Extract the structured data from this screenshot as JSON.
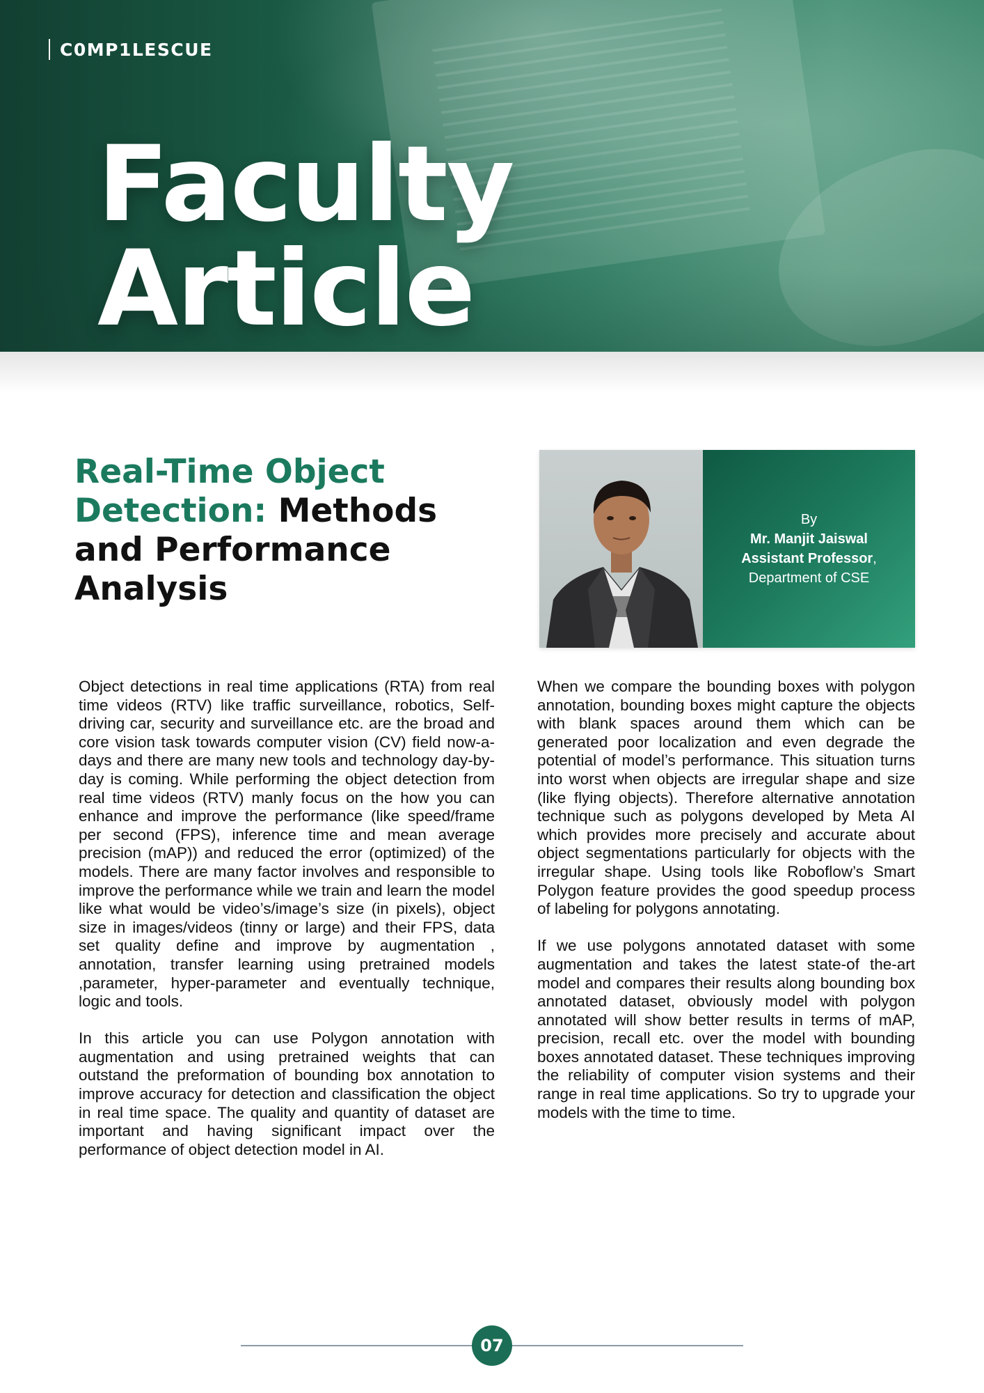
{
  "header": {
    "logo": "C0MP1LESCUE",
    "title_line1": "Faculty",
    "title_line2": "Article"
  },
  "article": {
    "title_accent": "Real-Time Object Detection:",
    "title_rest": "Methods and Performance Analysis"
  },
  "author": {
    "by": "By",
    "name": "Mr. Manjit Jaiswal",
    "role": "Assistant Professor",
    "role_suffix": ",",
    "department": "Department of CSE"
  },
  "body": {
    "left": [
      "Object detections in real time applications (RTA) from real time videos (RTV) like traffic surveillance, robotics, Self-driving car, security and surveillance etc. are the broad and core vision task towards computer vision (CV) field now-a-days and there are many new tools and technology day-by-day is coming. While performing the object detection from real time videos (RTV) manly focus on the how you can enhance and improve the performance (like speed/frame per second (FPS), inference time and mean average precision (mAP)) and reduced the error (optimized) of the models. There are many factor involves and responsible to improve the performance while we train and learn the model like what would be video’s/image’s size (in pixels), object size in images/videos (tinny or large) and their FPS, data set quality define and improve by augmentation , annotation, transfer learning using pretrained models ,parameter, hyper-parameter and eventually technique, logic and tools.",
      "In this article you can use Polygon annotation with augmentation and using pretrained weights that can outstand the preformation of bounding box annotation to improve accuracy for detection and classification the object in real time space. The quality and quantity of dataset are important and having significant impact over the performance of object detection model in AI."
    ],
    "right": [
      "When we compare the bounding boxes with polygon annotation, bounding boxes might capture the objects with blank spaces around them which can be generated poor localization and even degrade the potential of model’s performance. This situation turns into worst when objects are irregular shape and size (like flying objects). Therefore alternative annotation technique such as polygons developed by Meta AI which provides more precisely and accurate about object segmentations particularly for objects with the irregular shape. Using tools like Roboflow’s Smart Polygon feature provides the good speedup process of labeling for polygons annotating.",
      "If we use polygons annotated dataset with some augmentation and takes the latest state-of the-art model and compares their results along bounding box annotated dataset, obviously model with polygon annotated will show better results in terms of mAP, precision, recall etc. over the model with bounding boxes annotated dataset. These techniques improving the reliability of computer vision systems and their range in real time applications. So try to upgrade your models with the time to time."
    ]
  },
  "footer": {
    "page_number": "07"
  },
  "colors": {
    "accent_green": "#1b7a5e",
    "banner_dark": "#123f31",
    "badge": "#1b6e55"
  }
}
